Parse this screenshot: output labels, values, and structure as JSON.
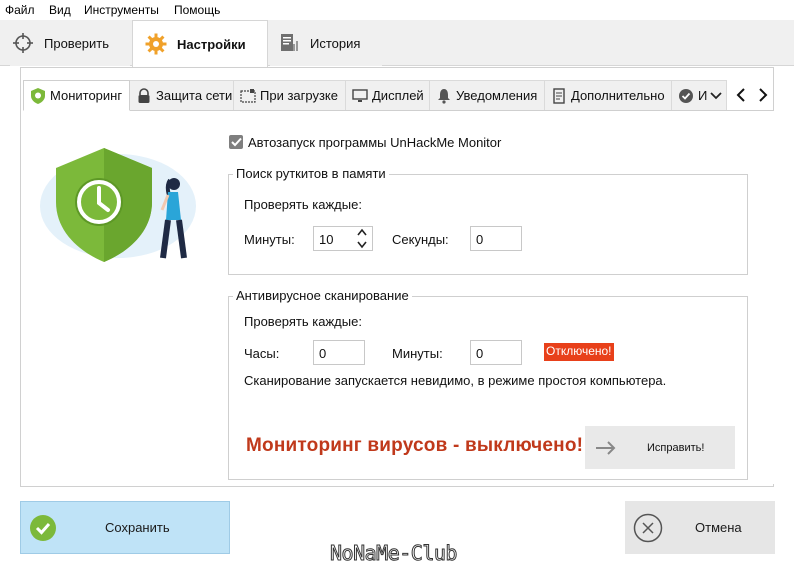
{
  "menu": {
    "file": "Файл",
    "view": "Вид",
    "tools": "Инструменты",
    "help": "Помощь"
  },
  "main_tabs": {
    "check": "Проверить",
    "settings": "Настройки",
    "history": "История"
  },
  "sub_tabs": {
    "monitoring": "Мониторинг",
    "net_protection": "Защита сети",
    "on_boot": "При загрузке",
    "display": "Дисплей",
    "notifications": "Уведомления",
    "advanced": "Дополнительно",
    "truncated": "И"
  },
  "autostart": {
    "label": "Автозапуск программы UnHackMe Monitor",
    "checked": true
  },
  "rootkit_group": {
    "title": "Поиск руткитов в памяти",
    "check_every": "Проверять каждые:",
    "minutes_label": "Минуты:",
    "minutes_value": "10",
    "seconds_label": "Секунды:",
    "seconds_value": "0"
  },
  "antivirus_group": {
    "title": "Антивирусное сканирование",
    "check_every": "Проверять каждые:",
    "hours_label": "Часы:",
    "hours_value": "0",
    "minutes_label": "Минуты:",
    "minutes_value": "0",
    "disabled_badge": "Отключено!",
    "note": "Сканирование запускается невидимо, в режиме простоя компьютера."
  },
  "virus_monitoring_status": "Мониторинг вирусов - выключено!",
  "fix_button": "Исправить!",
  "save_button": "Сохранить",
  "cancel_button": "Отмена",
  "watermark": "NoNaMe-Club",
  "colors": {
    "accent_orange": "#e8401a",
    "status_red": "#c0391b",
    "shield_green": "#7cb93a",
    "save_bg": "#bfe3f7"
  }
}
